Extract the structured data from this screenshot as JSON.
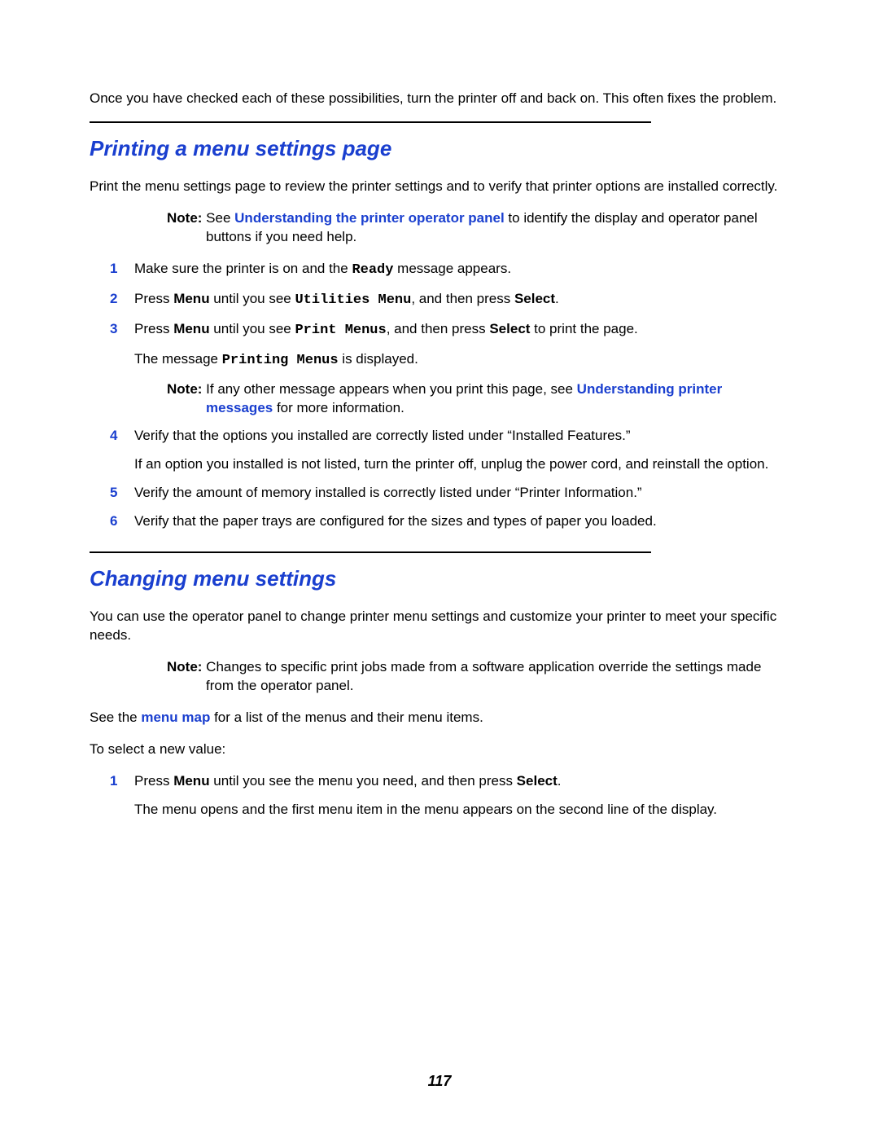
{
  "intro": {
    "text": "Once you have checked each of these possibilities, turn the printer off and back on. This often fixes the problem."
  },
  "section1": {
    "heading": "Printing a menu settings page",
    "intro_text": "Print the menu settings page to review the printer settings and to verify that printer options are installed correctly.",
    "note": {
      "label": "Note: ",
      "pre": "See ",
      "link": "Understanding the printer operator panel",
      "post": " to identify the display and operator panel buttons if you need help."
    },
    "steps": {
      "s1": {
        "num": "1",
        "t1": "Make sure the printer is on and the ",
        "mono1": "Ready",
        "t2": " message appears."
      },
      "s2": {
        "num": "2",
        "t1": "Press ",
        "b1": "Menu",
        "t2": " until you see ",
        "mono1": "Utilities Menu",
        "t3": ", and then press ",
        "b2": "Select",
        "t4": "."
      },
      "s3": {
        "num": "3",
        "t1": "Press ",
        "b1": "Menu",
        "t2": " until you see ",
        "mono1": "Print Menus",
        "t3": ", and then press ",
        "b2": "Select",
        "t4": " to print the page.",
        "sub_t1": "The message ",
        "sub_mono": "Printing Menus",
        "sub_t2": " is displayed.",
        "note": {
          "label": "Note: ",
          "pre": "If any other message appears when you print this page, see ",
          "link": "Understanding printer messages",
          "post": " for more information."
        }
      },
      "s4": {
        "num": "4",
        "t1": "Verify that the options you installed are correctly listed under “Installed Features.”",
        "sub": "If an option you installed is not listed, turn the printer off, unplug the power cord, and reinstall the option."
      },
      "s5": {
        "num": "5",
        "t1": "Verify the amount of memory installed is correctly listed under “Printer Information.”"
      },
      "s6": {
        "num": "6",
        "t1": "Verify that the paper trays are configured for the sizes and types of paper you loaded."
      }
    }
  },
  "section2": {
    "heading": "Changing menu settings",
    "intro_text": "You can use the operator panel to change printer menu settings and customize your printer to meet your specific needs.",
    "note": {
      "label": "Note: ",
      "text": "Changes to specific print jobs made from a software application override the settings made from the operator panel."
    },
    "see": {
      "t1": "See the ",
      "link": "menu map",
      "t2": " for a list of the menus and their menu items."
    },
    "select_intro": "To select a new value:",
    "steps": {
      "s1": {
        "num": "1",
        "t1": "Press ",
        "b1": "Menu",
        "t2": " until you see the menu you need, and then press ",
        "b2": "Select",
        "t3": ".",
        "sub": "The menu opens and the first menu item in the menu appears on the second line of the display."
      }
    }
  },
  "page_number": "117"
}
